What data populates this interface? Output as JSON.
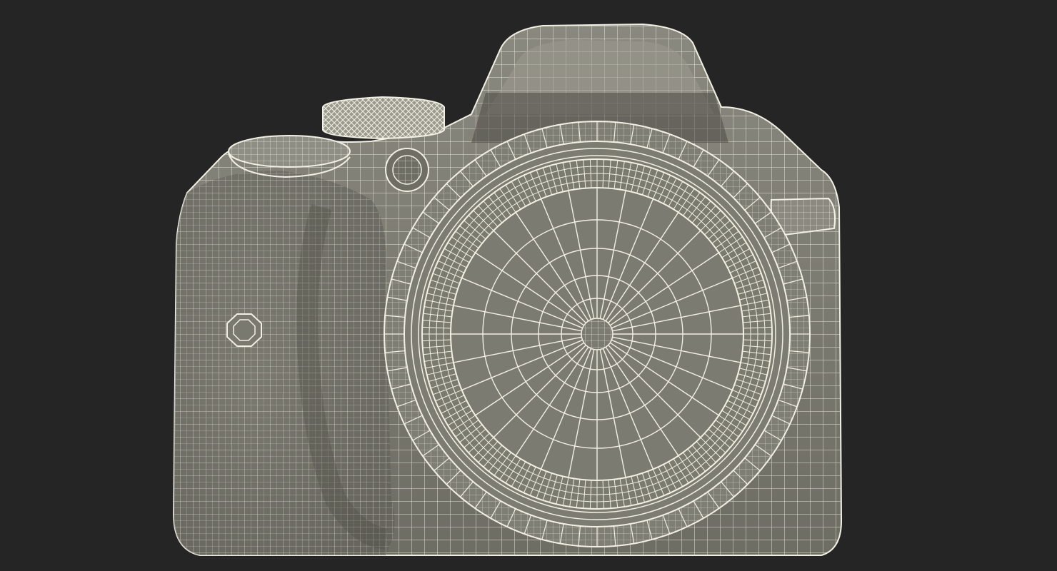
{
  "scene": {
    "background_color": "#252525",
    "subject": "camera-wireframe-render",
    "body_fill_color": "#7d7c72",
    "body_shade_color": "#5e5d55",
    "wire_color": "#f1f0e3",
    "lens_cap_color": "#7a7a6f"
  }
}
